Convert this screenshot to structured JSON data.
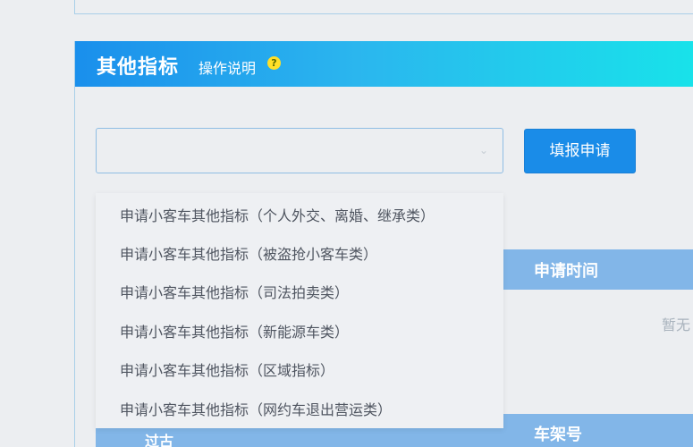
{
  "panel": {
    "title": "其他指标",
    "help_label": "操作说明",
    "help_icon_glyph": "?"
  },
  "form": {
    "select_value": "",
    "submit_label": "填报申请"
  },
  "dropdown": {
    "options": [
      "申请小客车其他指标（个人外交、离婚、继承类）",
      "申请小客车其他指标（被盗抢小客车类）",
      "申请小客车其他指标（司法拍卖类）",
      "申请小客车其他指标（新能源车类）",
      "申请小客车其他指标（区域指标）",
      "申请小客车其他指标（网约车退出营运类）"
    ]
  },
  "table": {
    "headers": {
      "apply_time": "申请时间",
      "vin": "车架号",
      "left_partial": "过古"
    },
    "empty_text": "暂无"
  },
  "colors": {
    "header_gradient_start": "#1a8fec",
    "header_gradient_end": "#18e3ea",
    "button": "#1a8ce8",
    "column_header": "#82b6e8"
  }
}
